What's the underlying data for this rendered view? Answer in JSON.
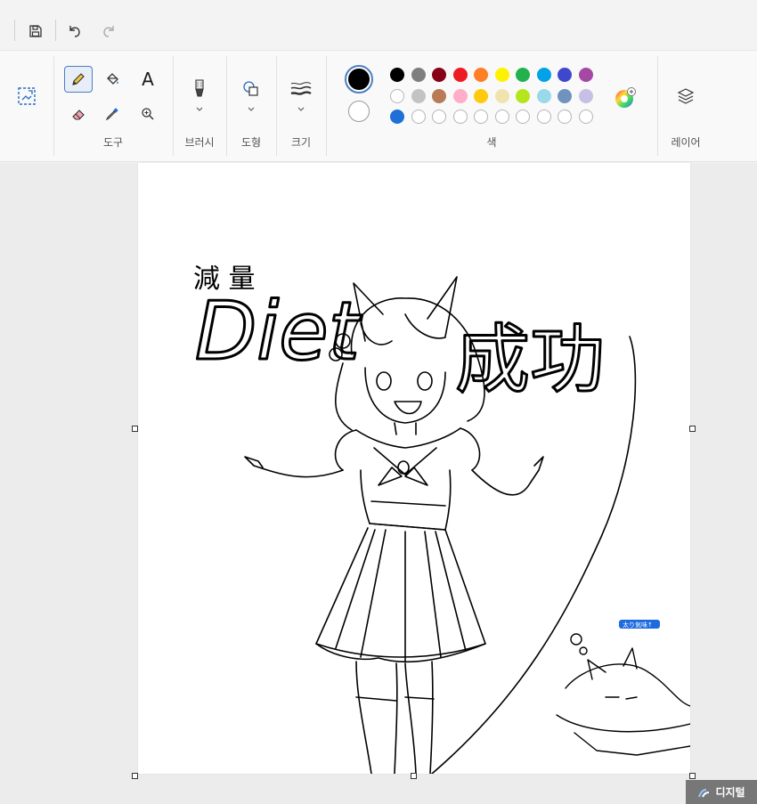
{
  "toolbar_groups": {
    "tools_label": "도구",
    "brushes_label": "브러시",
    "shapes_label": "도형",
    "size_label": "크기",
    "colors_label": "색",
    "layers_label": "레이어"
  },
  "tools": {
    "text_glyph": "A"
  },
  "colors": {
    "primary": "#000000",
    "secondary": "#ffffff",
    "palette_row1": [
      "#000000",
      "#7f7f7f",
      "#880015",
      "#ed1c24",
      "#ff7f27",
      "#fff200",
      "#22b14c",
      "#00a2e8",
      "#3f48cc",
      "#a349a4"
    ],
    "palette_row2": [
      "#ffffff",
      "#c3c3c3",
      "#b97a57",
      "#ffaec9",
      "#ffc90e",
      "#efe4b0",
      "#b5e61d",
      "#99d9ea",
      "#7092be",
      "#c8bfe7"
    ],
    "palette_row3_first": "#1f6fd8"
  },
  "canvas": {
    "drawing_title_kanji_top": "減 量",
    "drawing_diet": "Diet",
    "drawing_success": "成功",
    "drawing_tag": "太り気味↑"
  },
  "watermark": {
    "text": "디지털"
  }
}
